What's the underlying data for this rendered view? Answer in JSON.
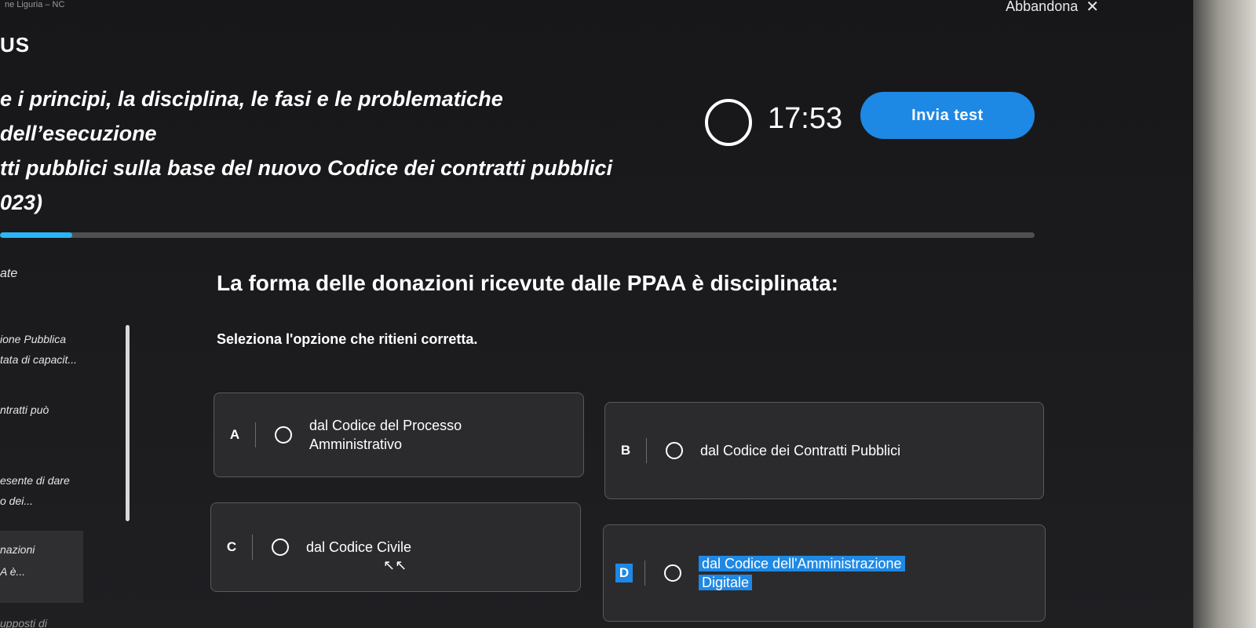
{
  "header": {
    "crumb": "ne Liguria – NC",
    "leave_label": "Abbandona",
    "close_icon": "close-icon",
    "logo_text": "US",
    "course_title_line1": "e i principi, la disciplina, le fasi e le problematiche dell’esecuzione",
    "course_title_line2": "tti pubblici sulla base del nuovo Codice dei contratti pubblici",
    "course_title_line3": "023)",
    "timer": "17:53",
    "submit_label": "Invia test"
  },
  "progress": {
    "fraction": 0.07
  },
  "sidebar": {
    "section_label": "ate",
    "items": [
      "ione Pubblica",
      "tata di capacit...",
      "ntratti può",
      "esente di dare",
      "o dei...",
      "nazioni",
      "A è..."
    ]
  },
  "question": {
    "text": "La forma delle donazioni ricevute dalle PPAA è disciplinata:",
    "instruction": "Seleziona l'opzione che ritieni corretta."
  },
  "options": [
    {
      "letter": "A",
      "line1": "dal Codice del Processo",
      "line2": "Amministrativo"
    },
    {
      "letter": "B",
      "line1": "dal Codice dei Contratti Pubblici",
      "line2": ""
    },
    {
      "letter": "C",
      "line1": "dal Codice Civile",
      "line2": ""
    },
    {
      "letter": "D",
      "line1": "dal Codice dell'Amministrazione",
      "line2": "Digitale"
    }
  ],
  "footer": {
    "cut_text": "upposti di"
  },
  "colors": {
    "accent": "#1e88e5",
    "progress": "#29b6f6",
    "background": "#1c1c1e"
  }
}
